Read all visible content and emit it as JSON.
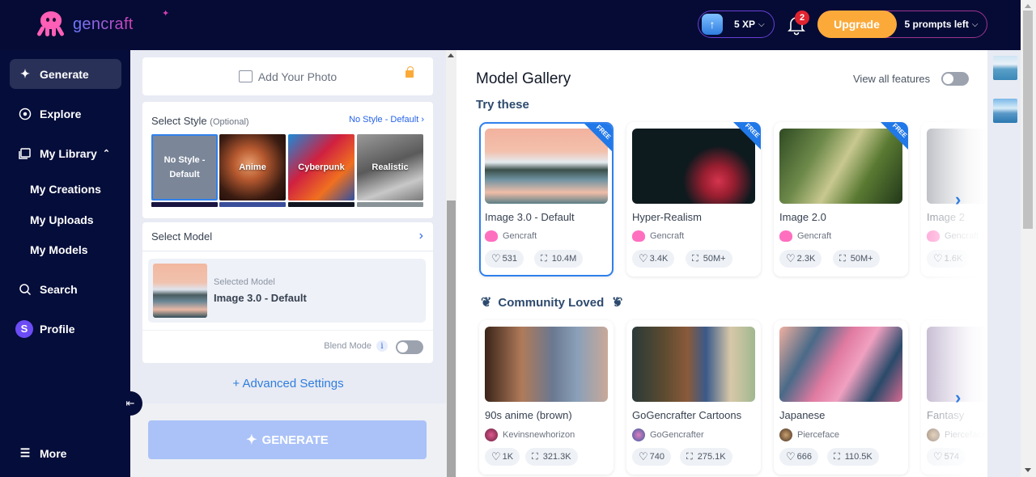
{
  "header": {
    "logo_text": "gencraft",
    "xp_label": "5 XP",
    "notification_count": "2",
    "upgrade_label": "Upgrade",
    "prompts_left": "5 prompts left"
  },
  "sidebar": {
    "items": [
      {
        "label": "Generate",
        "icon": "sparkles-icon",
        "active": true
      },
      {
        "label": "Explore",
        "icon": "compass-icon"
      },
      {
        "label": "My Library",
        "icon": "library-icon"
      },
      {
        "label": "Search",
        "icon": "search-icon"
      },
      {
        "label": "Profile",
        "icon": "avatar",
        "avatar_letter": "S"
      },
      {
        "label": "More",
        "icon": "menu-icon"
      }
    ],
    "library_sub": [
      "My Creations",
      "My Uploads",
      "My Models"
    ]
  },
  "left_panel": {
    "add_photo_label": "Add Your Photo",
    "style": {
      "title": "Select Style",
      "optional": "(Optional)",
      "current_link": "No Style - Default",
      "tiles": [
        "No Style - Default",
        "Anime",
        "Cyberpunk",
        "Realistic"
      ]
    },
    "model": {
      "title": "Select Model",
      "selected_label": "Selected Model",
      "selected_name": "Image 3.0 - Default",
      "blend_mode_label": "Blend Mode",
      "blend_mode_on": false
    },
    "advanced_settings": "+ Advanced Settings",
    "generate_label": "GENERATE"
  },
  "gallery": {
    "title": "Model Gallery",
    "view_all_label": "View all features",
    "view_all_on": false,
    "try_these_title": "Try these",
    "try_these": [
      {
        "name": "Image 3.0 - Default",
        "author": "Gencraft",
        "likes": "531",
        "uses": "10.4M",
        "badge": "FREE",
        "selected": true
      },
      {
        "name": "Hyper-Realism",
        "author": "Gencraft",
        "likes": "3.4K",
        "uses": "50M+",
        "badge": "FREE"
      },
      {
        "name": "Image 2.0",
        "author": "Gencraft",
        "likes": "2.3K",
        "uses": "50M+",
        "badge": "FREE"
      },
      {
        "name": "Image 2",
        "author": "Gencraft",
        "likes": "1.6K",
        "uses": ""
      }
    ],
    "community_title": "Community Loved",
    "community": [
      {
        "name": "90s anime (brown)",
        "author": "Kevinsnewhorizon",
        "likes": "1K",
        "uses": "321.3K"
      },
      {
        "name": "GoGencrafter Cartoons",
        "author": "GoGencrafter",
        "likes": "740",
        "uses": "275.1K"
      },
      {
        "name": "Japanese",
        "author": "Pierceface",
        "likes": "666",
        "uses": "110.5K"
      },
      {
        "name": "Fantasy",
        "author": "Pierceface",
        "likes": "574",
        "uses": ""
      }
    ]
  },
  "colors": {
    "header_bg": "#050b35",
    "accent_blue": "#2f80ed",
    "upgrade_orange": "#fbaa3a",
    "badge_red": "#e0242f"
  }
}
